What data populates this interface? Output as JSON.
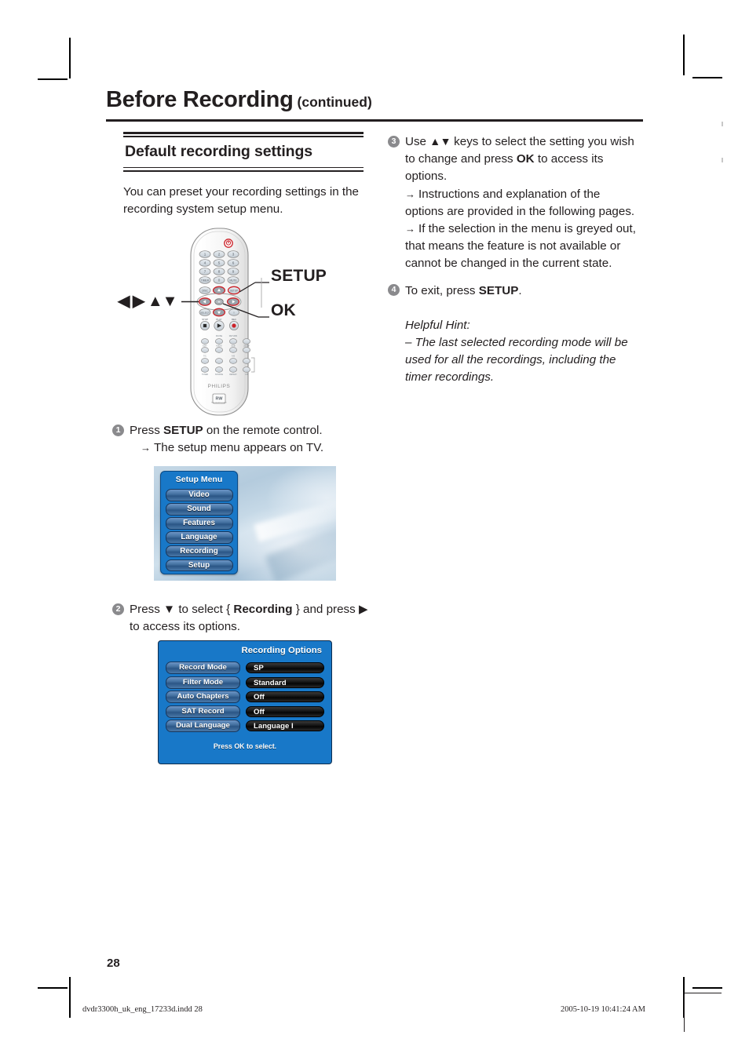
{
  "header": {
    "title": "Before Recording",
    "continued": "(continued)"
  },
  "left_column": {
    "section_heading": "Default recording settings",
    "intro": "You can preset your recording settings in the recording system setup menu.",
    "step1": {
      "number": "1",
      "text_before_bold": "Press ",
      "bold": "SETUP",
      "text_after_bold": " on the remote control.",
      "sub_arrow": "→",
      "sub_text": "The setup menu appears on TV."
    },
    "step2": {
      "number": "2",
      "part1": "Press ",
      "arrow_down": "▼",
      "part2": " to select { ",
      "bold": "Recording",
      "part3": " } and press ",
      "arrow_right": "▶",
      "part4": " to access its options."
    }
  },
  "remote": {
    "brand": "PHILIPS",
    "disc_logo": "RW",
    "callout_setup": "SETUP",
    "callout_ok": "OK",
    "callout_arrows": "◀ ▶ ▲▼"
  },
  "setup_menu": {
    "title": "Setup Menu",
    "items": [
      "Video",
      "Sound",
      "Features",
      "Language",
      "Recording",
      "Setup"
    ]
  },
  "recording_options": {
    "title": "Recording Options",
    "rows": [
      {
        "label": "Record Mode",
        "value": "SP"
      },
      {
        "label": "Filter Mode",
        "value": "Standard"
      },
      {
        "label": "Auto Chapters",
        "value": "Off"
      },
      {
        "label": "SAT Record",
        "value": "Off"
      },
      {
        "label": "Dual Language",
        "value": "Language I"
      }
    ],
    "hint": "Press OK to select."
  },
  "right_column": {
    "step3": {
      "number": "3",
      "part1": "Use ",
      "arrows": "▲▼",
      "part2": " keys to select the setting you wish to change and press ",
      "bold_ok": "OK",
      "part3": " to access its options.",
      "sub1_arrow": "→",
      "sub1_text": "Instructions and explanation of the options are provided in the following pages.",
      "sub2_arrow": "→",
      "sub2_text": "If the selection in the menu is greyed out, that means the feature is not available or cannot be changed in the current state."
    },
    "step4": {
      "number": "4",
      "part1": "To exit, press ",
      "bold": "SETUP",
      "part2": "."
    },
    "hint_title": "Helpful Hint:",
    "hint_body": "–  The last selected recording mode will be used for all the recordings, including the timer recordings."
  },
  "footer": {
    "page_number": "28",
    "file": "dvdr3300h_uk_eng_17233d.indd   28",
    "timestamp": "2005-10-19   10:41:24 AM"
  },
  "colors": {
    "ink": "#231f20",
    "menu_blue": "#1878c8",
    "button_blue": "#43709f",
    "value_black": "#141414",
    "bullet_gray": "#8a8a8d"
  }
}
